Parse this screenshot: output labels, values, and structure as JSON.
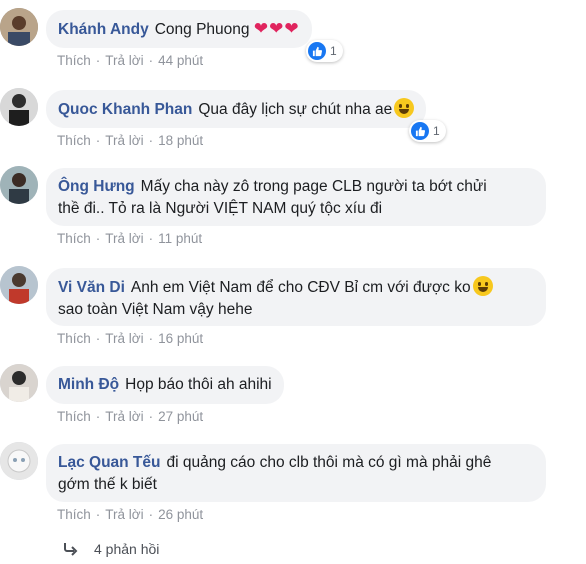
{
  "colors": {
    "author": "#385898",
    "bubble": "#f2f3f5",
    "action": "#90949c",
    "like": "#1877f2"
  },
  "comments": [
    {
      "author": "Khánh Andy",
      "text": "Cong Phuong",
      "hearts": "❤❤❤",
      "reaction_icon": "like-icon",
      "reactions": "1",
      "like_label": "Thích",
      "reply_label": "Trả lời",
      "time": "44 phút"
    },
    {
      "author": "Quoc Khanh Phan",
      "text": "Qua đây lịch sự chút nha ae",
      "emoji": "laughing-emoji",
      "reaction_icon": "like-icon",
      "reactions": "1",
      "like_label": "Thích",
      "reply_label": "Trả lời",
      "time": "18 phút"
    },
    {
      "author": "Ông Hưng",
      "text_line1": "Mấy cha này zô trong page CLB người ta bớt chửi",
      "text_line2": "thề đi.. Tỏ ra là Người VIỆT NAM quý tộc xíu đi",
      "like_label": "Thích",
      "reply_label": "Trả lời",
      "time": "11 phút"
    },
    {
      "author": "Vi Văn Di",
      "text_line1": "Anh em Việt Nam để cho CĐV Bỉ cm với được ko",
      "text_line2": "sao toàn Việt Nam vậy hehe",
      "emoji": "grinning-emoji",
      "like_label": "Thích",
      "reply_label": "Trả lời",
      "time": "16 phút"
    },
    {
      "author": "Minh Độ",
      "text": "Họp báo thôi ah ahihi",
      "like_label": "Thích",
      "reply_label": "Trả lời",
      "time": "27 phút"
    },
    {
      "author": "Lạc Quan Tếu",
      "text_line1": "đi quảng cáo cho clb thôi mà có gì mà phải ghê",
      "text_line2": "gớm thế k biết",
      "like_label": "Thích",
      "reply_label": "Trả lời",
      "time": "26 phút"
    }
  ],
  "replies": {
    "icon": "reply-arrow-icon",
    "label": "4 phản hồi"
  },
  "separator": "·"
}
